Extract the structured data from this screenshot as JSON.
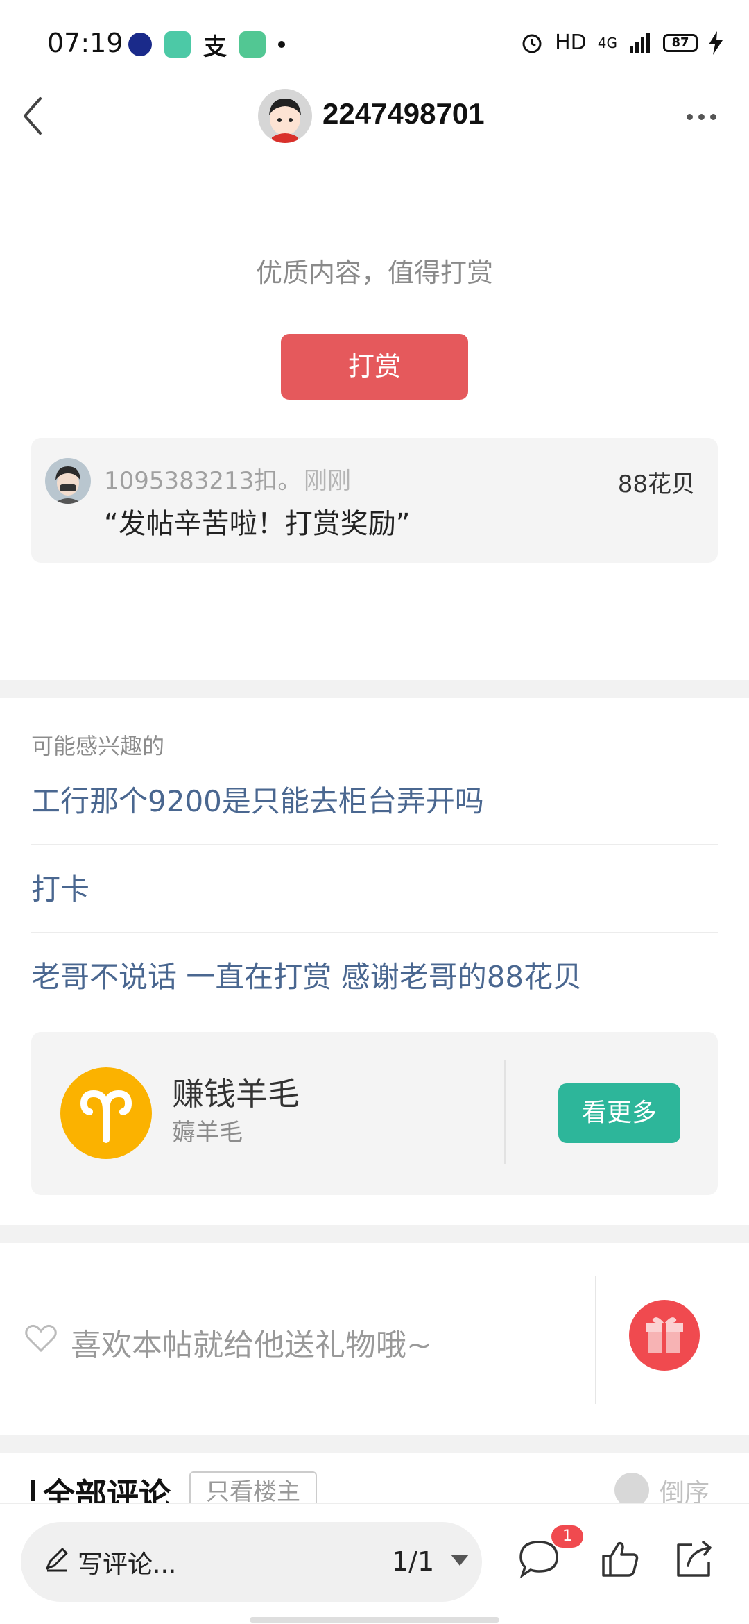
{
  "status_bar": {
    "time": "07:19",
    "hd": "HD",
    "network": "4G",
    "battery": "87"
  },
  "header": {
    "username": "2247498701",
    "back_icon": "chevron-left-icon",
    "more_icon": "more-dots-icon"
  },
  "reward": {
    "prompt": "优质内容，值得打赏",
    "button_label": "打赏",
    "tip": {
      "user": "1095383213扣。",
      "time": "刚刚",
      "amount": "88花贝",
      "message": "“发帖辛苦啦！打赏奖励”"
    }
  },
  "interests": {
    "title": "可能感兴趣的",
    "items": [
      "工行那个9200是只能去柜台弄开吗",
      "打卡",
      "老哥不说话 一直在打赏 感谢老哥的88花贝"
    ]
  },
  "group": {
    "name": "赚钱羊毛",
    "subtitle": "薅羊毛",
    "button_label": "看更多",
    "icon": "aries-icon"
  },
  "gift": {
    "text": "喜欢本帖就给他送礼物哦~",
    "icon": "gift-icon"
  },
  "comments": {
    "title": "全部评论",
    "only_op": "只看楼主",
    "sort": "倒序"
  },
  "bottom_bar": {
    "write_placeholder": "写评论...",
    "page": "1/1",
    "comment_badge": "1"
  },
  "colors": {
    "reward_red": "#e5595c",
    "link_blue": "#4a6790",
    "green_button": "#2db69a",
    "group_yellow": "#fbb200"
  }
}
